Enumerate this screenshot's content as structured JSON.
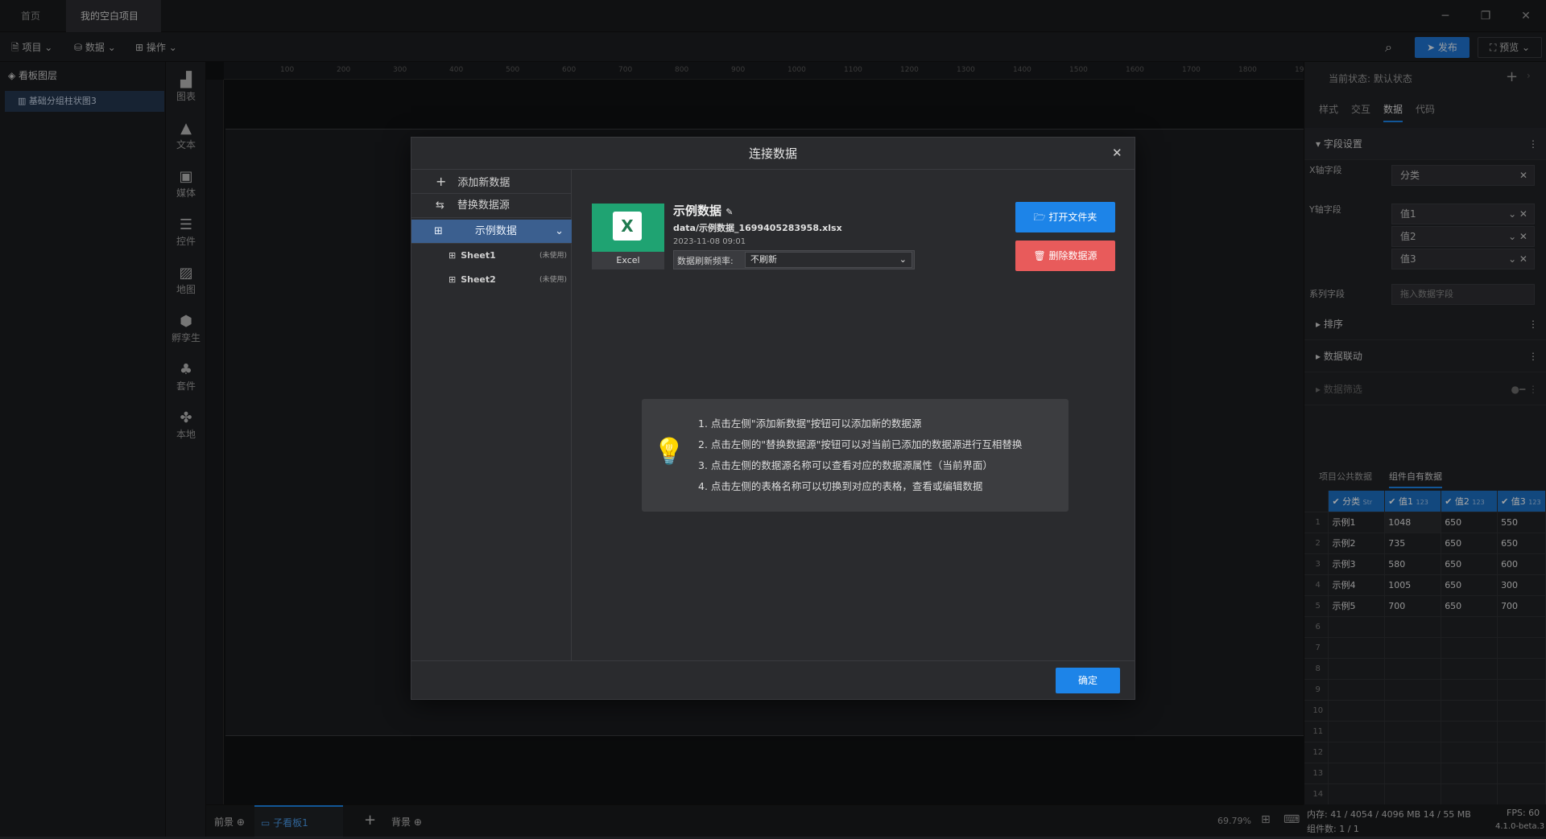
{
  "titlebar": {
    "tabs": [
      {
        "label": "首页"
      },
      {
        "label": "我的空白项目"
      }
    ]
  },
  "menubar": {
    "items": [
      {
        "label": "项目"
      },
      {
        "label": "数据"
      },
      {
        "label": "操作"
      }
    ],
    "publish": "发布",
    "preview": "预览"
  },
  "layers": {
    "header": "看板图层",
    "items": [
      {
        "label": "基础分组柱状图3"
      }
    ]
  },
  "toolbar": {
    "items": [
      {
        "label": "图表"
      },
      {
        "label": "文本"
      },
      {
        "label": "媒体"
      },
      {
        "label": "控件"
      },
      {
        "label": "地图"
      },
      {
        "label": "孵孪生"
      },
      {
        "label": "套件"
      },
      {
        "label": "本地"
      }
    ]
  },
  "ruler": {
    "h": [
      "100",
      "200",
      "300",
      "400",
      "500",
      "600",
      "700",
      "800",
      "900",
      "1000",
      "1100",
      "1200",
      "1300",
      "1400",
      "1500",
      "1600",
      "1700",
      "1800",
      "1900"
    ]
  },
  "bottombar": {
    "front": "前景",
    "board": "子看板1",
    "add": "+",
    "back": "背景",
    "zoom": "69.79%"
  },
  "rightpanel": {
    "state_label": "当前状态:",
    "state_value": "默认状态",
    "tabs": [
      {
        "label": "样式"
      },
      {
        "label": "交互"
      },
      {
        "label": "数据"
      },
      {
        "label": "代码"
      }
    ],
    "field_settings": "字段设置",
    "x_field_label": "X轴字段",
    "x_field_value": "分类",
    "y_field_label": "Y轴字段",
    "y_fields": [
      {
        "label": "值1"
      },
      {
        "label": "值2"
      },
      {
        "label": "值3"
      }
    ],
    "series_label": "系列字段",
    "series_placeholder": "拖入数据字段",
    "sort": "排序",
    "linkage": "数据联动",
    "filter": "数据筛选",
    "data_tabs": [
      {
        "label": "项目公共数据"
      },
      {
        "label": "组件自有数据"
      }
    ],
    "table": {
      "headers": [
        "分类",
        "值1",
        "值2",
        "值3"
      ],
      "header_types": [
        "Str",
        "123",
        "123",
        "123"
      ],
      "rows": [
        {
          "n": "1",
          "cells": [
            "示例1",
            "1048",
            "650",
            "550"
          ]
        },
        {
          "n": "2",
          "cells": [
            "示例2",
            "735",
            "650",
            "650"
          ]
        },
        {
          "n": "3",
          "cells": [
            "示例3",
            "580",
            "650",
            "600"
          ]
        },
        {
          "n": "4",
          "cells": [
            "示例4",
            "1005",
            "650",
            "300"
          ]
        },
        {
          "n": "5",
          "cells": [
            "示例5",
            "700",
            "650",
            "700"
          ]
        },
        {
          "n": "6",
          "cells": [
            "",
            "",
            "",
            ""
          ]
        },
        {
          "n": "7",
          "cells": [
            "",
            "",
            "",
            ""
          ]
        },
        {
          "n": "8",
          "cells": [
            "",
            "",
            "",
            ""
          ]
        },
        {
          "n": "9",
          "cells": [
            "",
            "",
            "",
            ""
          ]
        },
        {
          "n": "10",
          "cells": [
            "",
            "",
            "",
            ""
          ]
        },
        {
          "n": "11",
          "cells": [
            "",
            "",
            "",
            ""
          ]
        },
        {
          "n": "12",
          "cells": [
            "",
            "",
            "",
            ""
          ]
        },
        {
          "n": "13",
          "cells": [
            "",
            "",
            "",
            ""
          ]
        },
        {
          "n": "14",
          "cells": [
            "",
            "",
            "",
            ""
          ]
        }
      ]
    }
  },
  "statusbar": {
    "memory": "内存: 41 / 4054 / 4096 MB 14 / 55 MB",
    "fps": "FPS: 60",
    "components": "组件数: 1 / 1",
    "version": "4.1.0-beta.3"
  },
  "dialog": {
    "title": "连接数据",
    "side": {
      "add": "添加新数据",
      "replace": "替换数据源",
      "source": "示例数据",
      "sheets": [
        {
          "label": "Sheet1",
          "status": "(未使用)"
        },
        {
          "label": "Sheet2",
          "status": "(未使用)"
        }
      ]
    },
    "source": {
      "excel_label": "Excel",
      "name": "示例数据",
      "path": "data/示例数据_1699405283958.xlsx",
      "date": "2023-11-08 09:01",
      "refresh_label": "数据刷新频率:",
      "refresh_value": "不刷新"
    },
    "open_folder": "打开文件夹",
    "delete_source": "删除数据源",
    "tips": [
      "1. 点击左侧\"添加新数据\"按钮可以添加新的数据源",
      "2. 点击左侧的\"替换数据源\"按钮可以对当前已添加的数据源进行互相替换",
      "3. 点击左侧的数据源名称可以查看对应的数据源属性（当前界面）",
      "4. 点击左侧的表格名称可以切换到对应的表格，查看或编辑数据"
    ],
    "confirm": "确定"
  }
}
